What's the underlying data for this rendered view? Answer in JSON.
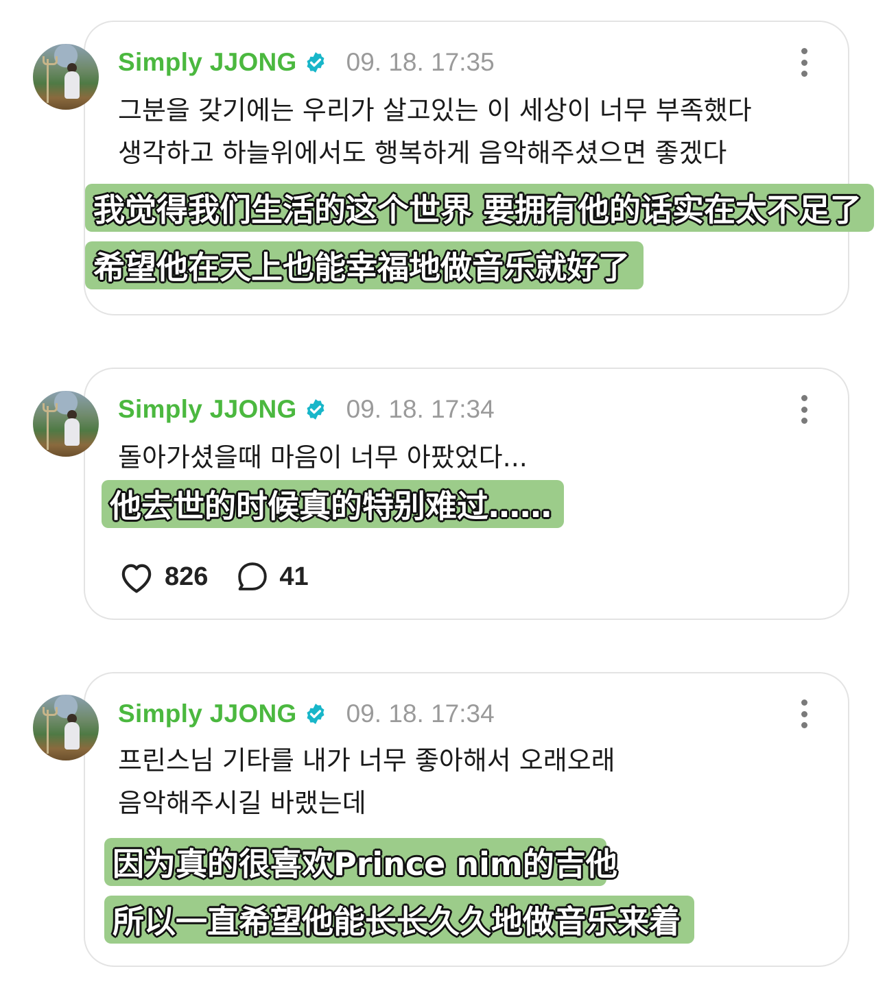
{
  "colors": {
    "author": "#4bb83f",
    "verified": "#18b6c9",
    "subtitle_bg": "#9ccc8a"
  },
  "posts": [
    {
      "author": "Simply JJONG",
      "time": "09. 18. 17:35",
      "text_lines": [
        "그분을 갖기에는 우리가 살고있는 이 세상이 너무 부족했다",
        "생각하고 하늘위에서도 행복하게 음악해주셨으면 좋겠다"
      ],
      "subtitles": [
        "我觉得我们生活的这个世界 要拥有他的话实在太不足了",
        "希望他在天上也能幸福地做音乐就好了"
      ]
    },
    {
      "author": "Simply JJONG",
      "time": "09. 18. 17:34",
      "text_lines": [
        "돌아가셨을때 마음이 너무 아팠었다..."
      ],
      "subtitles": [
        "他去世的时候真的特别难过……"
      ],
      "likes": "826",
      "comments": "41"
    },
    {
      "author": "Simply JJONG",
      "time": "09. 18. 17:34",
      "text_lines": [
        "프린스님 기타를 내가 너무 좋아해서 오래오래",
        "음악해주시길 바랬는데"
      ],
      "subtitles": [
        "因为真的很喜欢Prince nim的吉他",
        "所以一直希望他能长长久久地做音乐来着"
      ]
    }
  ]
}
